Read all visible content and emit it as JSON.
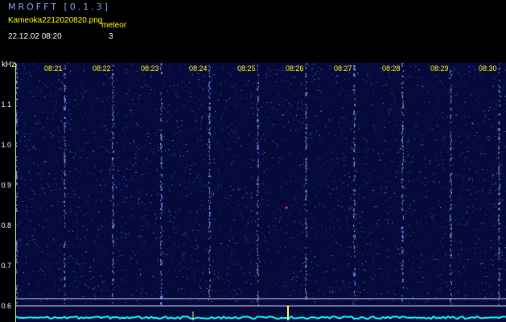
{
  "header": {
    "app_title": "MROFFT [0.1.3]",
    "filename": "Kameoka2212020820.png",
    "timestamp": "22.12.02 08:20",
    "detection_label": "meteor",
    "detection_count": "3"
  },
  "axes": {
    "unit": "kHz",
    "y_ticks": [
      "1.1",
      "1.0",
      "0.9",
      "0.8",
      "0.7",
      "0.6"
    ],
    "x_ticks": [
      "08:21",
      "08:22",
      "08:23",
      "08:24",
      "08:25",
      "08:26",
      "08:27",
      "08:28",
      "08:29",
      "08:30"
    ]
  },
  "colors": {
    "background": "#060a3a",
    "noise": "#3a4cff",
    "time_marker": "#8fa0ff",
    "baseline": "#00ffff",
    "label_yellow": "#ffff00"
  }
}
